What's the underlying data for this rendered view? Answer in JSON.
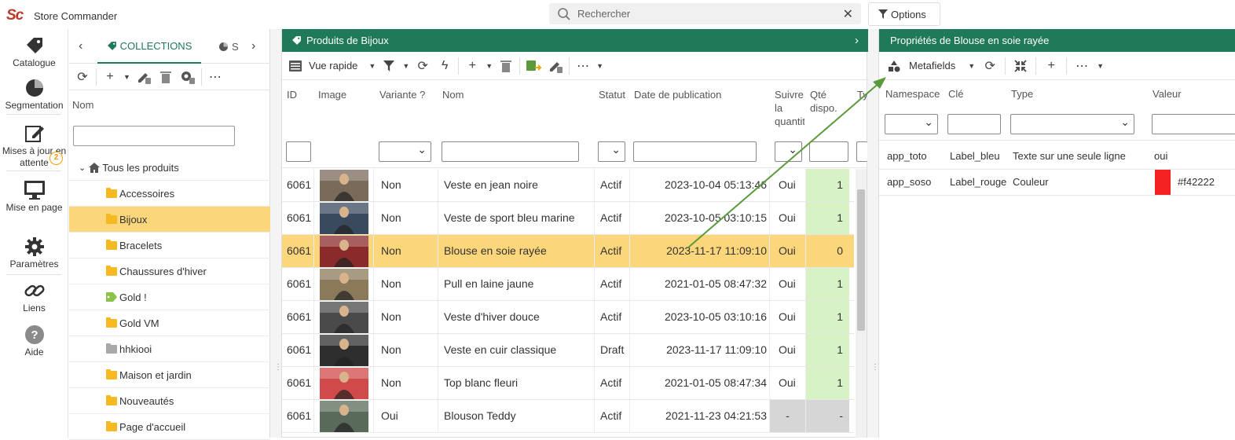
{
  "app": {
    "logo": "Sc",
    "title": "Store Commander"
  },
  "search": {
    "placeholder": "Rechercher"
  },
  "options": {
    "label": "Options"
  },
  "nav": [
    {
      "label": "Catalogue",
      "icon": "tag-icon"
    },
    {
      "label": "Segmentation",
      "icon": "pie-chart-icon"
    },
    {
      "label": "Mises à jour en attente",
      "icon": "edit-icon",
      "badge": "2"
    },
    {
      "label": "Mise en page",
      "icon": "monitor-icon"
    },
    {
      "label": "Paramètres",
      "icon": "gear-icon"
    },
    {
      "label": "Liens",
      "icon": "link-icon"
    },
    {
      "label": "Aide",
      "icon": "help-icon"
    }
  ],
  "collections": {
    "tab_active": "COLLECTIONS",
    "tab_other": "S",
    "column_label": "Nom",
    "filter_value": "",
    "tree": [
      {
        "label": "Tous les produits",
        "type": "root"
      },
      {
        "label": "Accessoires",
        "type": "folder"
      },
      {
        "label": "Bijoux",
        "type": "folder",
        "selected": true
      },
      {
        "label": "Bracelets",
        "type": "folder"
      },
      {
        "label": "Chaussures d'hiver",
        "type": "folder"
      },
      {
        "label": "Gold !",
        "type": "tag"
      },
      {
        "label": "Gold VM",
        "type": "folder"
      },
      {
        "label": "hhkiooi",
        "type": "grey-folder"
      },
      {
        "label": "Maison et jardin",
        "type": "folder"
      },
      {
        "label": "Nouveautés",
        "type": "folder"
      },
      {
        "label": "Page d'accueil",
        "type": "folder"
      }
    ]
  },
  "products": {
    "title": "Produits de Bijoux",
    "view_label": "Vue rapide",
    "columns": {
      "id": "ID",
      "image": "Image",
      "variant": "Variante ?",
      "name": "Nom",
      "status": "Statut",
      "pubdate": "Date de publication",
      "follow": "Suivre la quantité",
      "qty": "Qté dispo.",
      "type": "Ty"
    },
    "rows": [
      {
        "id": "6061",
        "variant": "Non",
        "name": "Veste en jean noire",
        "status": "Actif",
        "date": "2023-10-04 05:13:46",
        "follow": "Oui",
        "qty": "1",
        "img": "#7a6a5a"
      },
      {
        "id": "6061",
        "variant": "Non",
        "name": "Veste de sport bleu marine",
        "status": "Actif",
        "date": "2023-10-05 03:10:15",
        "follow": "Oui",
        "qty": "1",
        "img": "#3a4a5e"
      },
      {
        "id": "6061",
        "variant": "Non",
        "name": "Blouse en soie rayée",
        "status": "Actif",
        "date": "2023-11-17 11:09:10",
        "follow": "Oui",
        "qty": "0",
        "img": "#8a2a2a",
        "selected": true
      },
      {
        "id": "6061",
        "variant": "Non",
        "name": "Pull en laine jaune",
        "status": "Actif",
        "date": "2021-01-05 08:47:32",
        "follow": "Oui",
        "qty": "1",
        "img": "#8a7a5a"
      },
      {
        "id": "6061",
        "variant": "Non",
        "name": "Veste d'hiver douce",
        "status": "Actif",
        "date": "2023-10-05 03:10:16",
        "follow": "Oui",
        "qty": "1",
        "img": "#4a4a4a"
      },
      {
        "id": "6061",
        "variant": "Non",
        "name": "Veste en cuir classique",
        "status": "Draft",
        "date": "2023-11-17 11:09:10",
        "follow": "Oui",
        "qty": "1",
        "img": "#2e2e2e"
      },
      {
        "id": "6061",
        "variant": "Non",
        "name": "Top blanc fleuri",
        "status": "Actif",
        "date": "2021-01-05 08:47:34",
        "follow": "Oui",
        "qty": "1",
        "img": "#d04a4a"
      },
      {
        "id": "6061",
        "variant": "Oui",
        "name": "Blouson Teddy",
        "status": "Actif",
        "date": "2021-11-23 04:21:53",
        "follow": "-",
        "qty": "-",
        "img": "#5a6a5a"
      }
    ]
  },
  "properties": {
    "title": "Propriétés de Blouse en soie rayée",
    "tool_label": "Metafields",
    "columns": {
      "namespace": "Namespace",
      "key": "Clé",
      "type": "Type",
      "value": "Valeur"
    },
    "rows": [
      {
        "namespace": "app_toto",
        "key": "Label_bleu",
        "type": "Texte sur une seule ligne",
        "value": "oui"
      },
      {
        "namespace": "app_soso",
        "key": "Label_rouge",
        "type": "Couleur",
        "value": "#f42222",
        "swatch": "#f42222"
      }
    ]
  },
  "colors": {
    "accent": "#1f7a59",
    "selection": "#fbd67a",
    "qty_bg": "#d7f3c6",
    "arrow": "#5a9a3a"
  }
}
